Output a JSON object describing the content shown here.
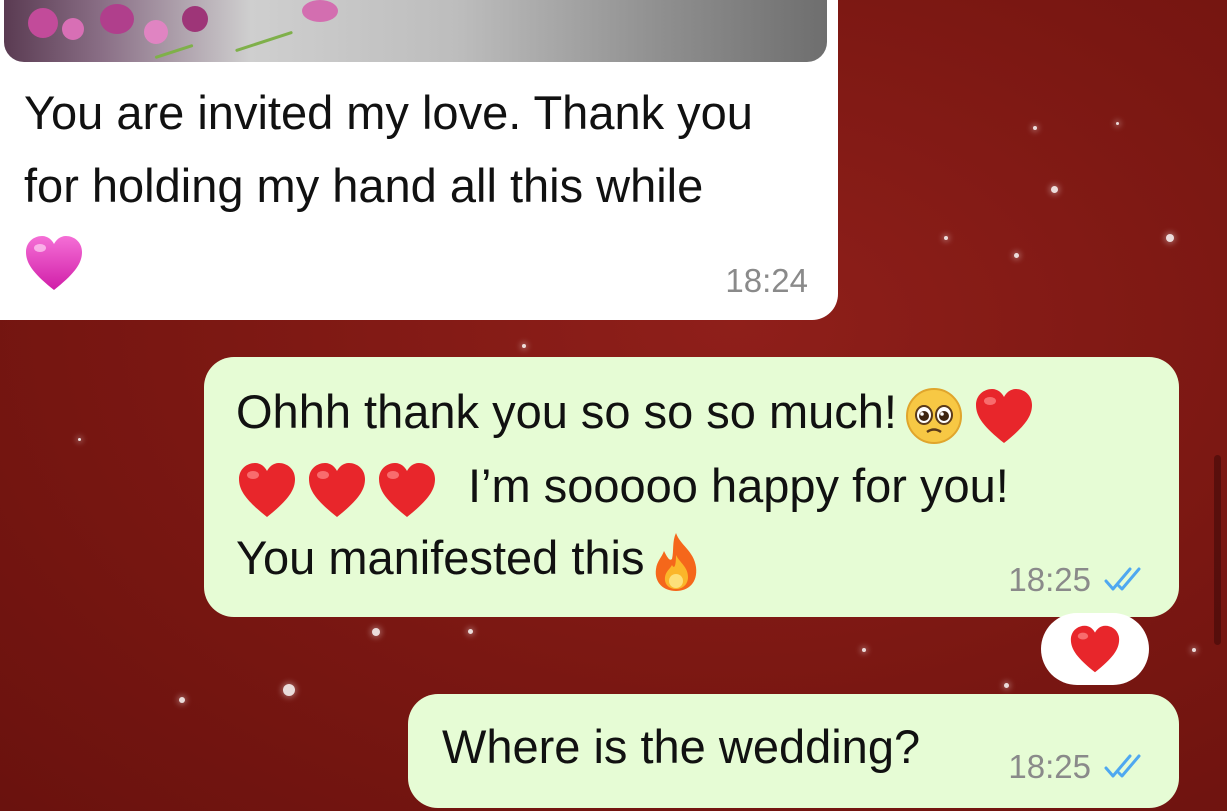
{
  "chat": {
    "incoming": {
      "text_line1": "You are invited my love. Thank you",
      "text_line2": "for holding my hand all this while",
      "emoji": "pink-heart",
      "time": "18:24"
    },
    "outgoing": [
      {
        "line1": "Ohhh thank you so so so much!",
        "line2": "I’m sooooo happy for you!",
        "line3": "You manifested this",
        "time": "18:25",
        "status": "read",
        "reaction": "red-heart"
      },
      {
        "text": "Where is the wedding?",
        "time": "18:25",
        "status": "read"
      }
    ]
  },
  "colors": {
    "background": "#7a1712",
    "incoming_bubble": "#ffffff",
    "outgoing_bubble": "#e6fcd5",
    "read_ticks": "#4fa8f0",
    "time_text": "#8a8a8a"
  }
}
